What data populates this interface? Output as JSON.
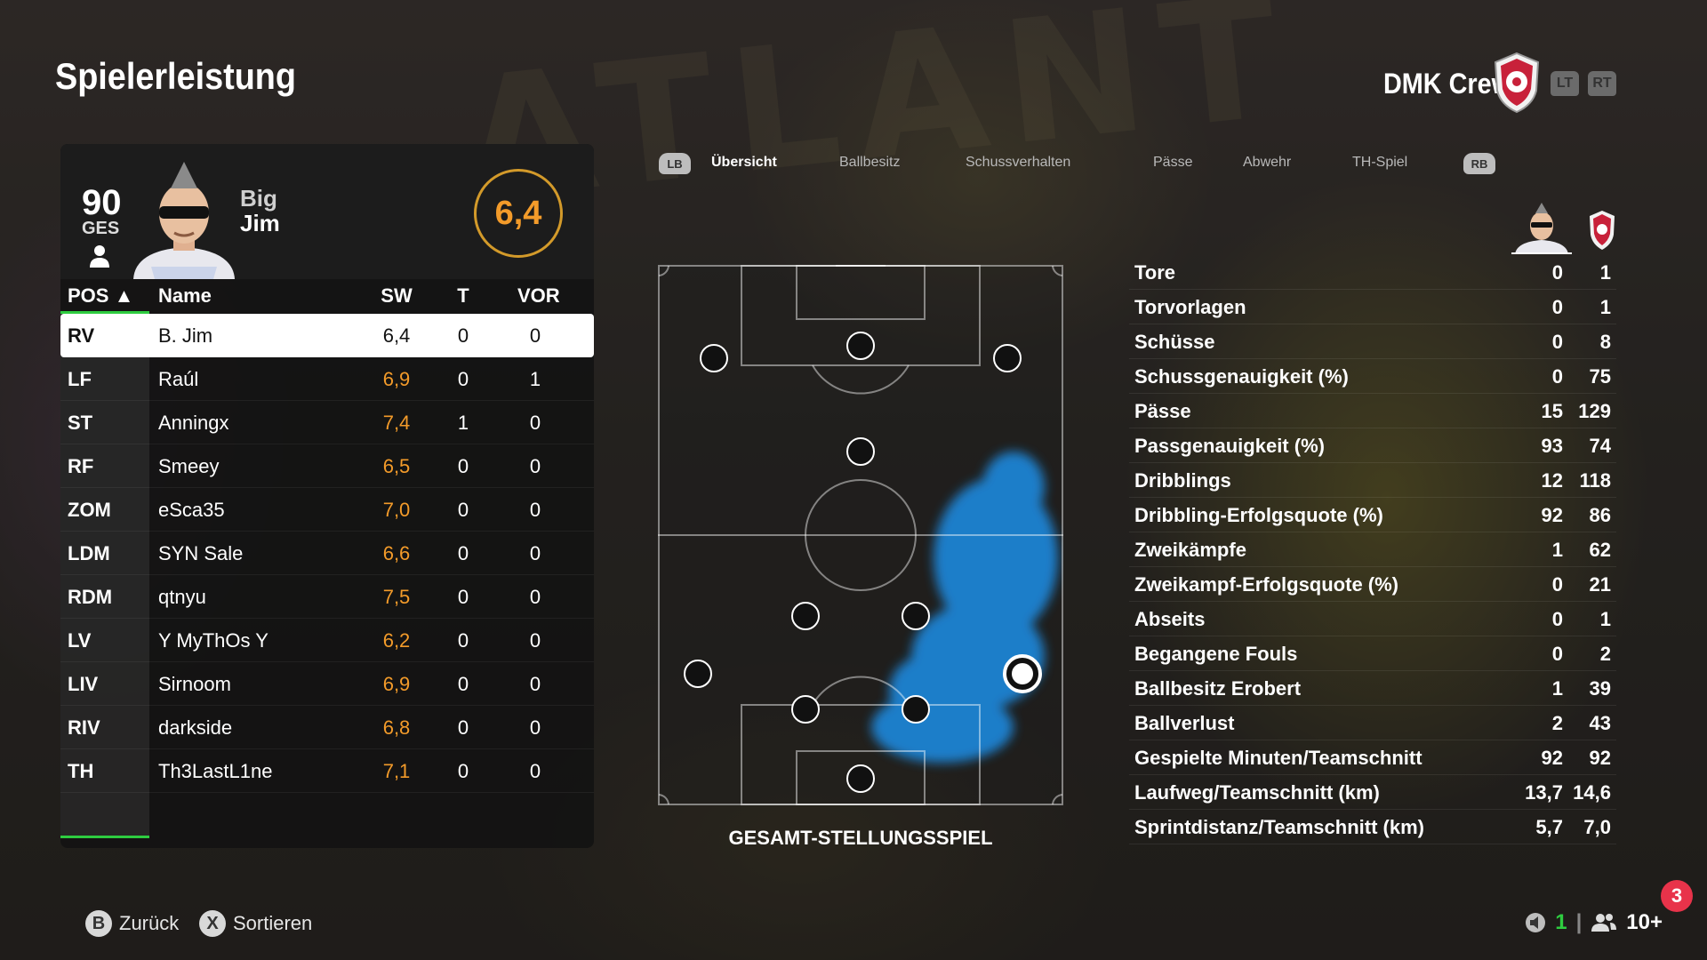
{
  "header": {
    "title": "Spielerleistung",
    "team_name": "DMK Crew",
    "lt": "LT",
    "rt": "RT"
  },
  "player_card": {
    "overall": "90",
    "overall_label": "GES",
    "first_name": "Big",
    "last_name": "Jim",
    "rating": "6,4"
  },
  "table": {
    "headers": {
      "pos": "POS ▲",
      "name": "Name",
      "sw": "SW",
      "t": "T",
      "vor": "VOR"
    },
    "rows": [
      {
        "pos": "RV",
        "name": "B. Jim",
        "sw": "6,4",
        "t": "0",
        "vor": "0"
      },
      {
        "pos": "LF",
        "name": "Raúl",
        "sw": "6,9",
        "t": "0",
        "vor": "1"
      },
      {
        "pos": "ST",
        "name": "Anningx",
        "sw": "7,4",
        "t": "1",
        "vor": "0"
      },
      {
        "pos": "RF",
        "name": "Smeey",
        "sw": "6,5",
        "t": "0",
        "vor": "0"
      },
      {
        "pos": "ZOM",
        "name": "eSca35",
        "sw": "7,0",
        "t": "0",
        "vor": "0"
      },
      {
        "pos": "LDM",
        "name": "SYN Sale",
        "sw": "6,6",
        "t": "0",
        "vor": "0"
      },
      {
        "pos": "RDM",
        "name": "qtnyu",
        "sw": "7,5",
        "t": "0",
        "vor": "0"
      },
      {
        "pos": "LV",
        "name": "Y MyThOs Y",
        "sw": "6,2",
        "t": "0",
        "vor": "0"
      },
      {
        "pos": "LIV",
        "name": "Sirnoom",
        "sw": "6,9",
        "t": "0",
        "vor": "0"
      },
      {
        "pos": "RIV",
        "name": "darkside",
        "sw": "6,8",
        "t": "0",
        "vor": "0"
      },
      {
        "pos": "TH",
        "name": "Th3LastL1ne",
        "sw": "7,1",
        "t": "0",
        "vor": "0"
      }
    ]
  },
  "tabs": {
    "lb": "LB",
    "rb": "RB",
    "items": [
      "Übersicht",
      "Ballbesitz",
      "Schussverhalten",
      "Pässe",
      "Abwehr",
      "TH-Spiel"
    ],
    "active": "Übersicht"
  },
  "pitch": {
    "label": "GESAMT-STELLUNGSSPIEL"
  },
  "stats": [
    {
      "label": "Tore",
      "player": "0",
      "team": "1"
    },
    {
      "label": "Torvorlagen",
      "player": "0",
      "team": "1"
    },
    {
      "label": "Schüsse",
      "player": "0",
      "team": "8"
    },
    {
      "label": "Schussgenauigkeit (%)",
      "player": "0",
      "team": "75"
    },
    {
      "label": "Pässe",
      "player": "15",
      "team": "129"
    },
    {
      "label": "Passgenauigkeit (%)",
      "player": "93",
      "team": "74"
    },
    {
      "label": "Dribblings",
      "player": "12",
      "team": "118"
    },
    {
      "label": "Dribbling-Erfolgsquote (%)",
      "player": "92",
      "team": "86"
    },
    {
      "label": "Zweikämpfe",
      "player": "1",
      "team": "62"
    },
    {
      "label": "Zweikampf-Erfolgsquote (%)",
      "player": "0",
      "team": "21"
    },
    {
      "label": "Abseits",
      "player": "0",
      "team": "1"
    },
    {
      "label": "Begangene Fouls",
      "player": "0",
      "team": "2"
    },
    {
      "label": "Ballbesitz Erobert",
      "player": "1",
      "team": "39"
    },
    {
      "label": "Ballverlust",
      "player": "2",
      "team": "43"
    },
    {
      "label": "Gespielte Minuten/Teamschnitt",
      "player": "92",
      "team": "92"
    },
    {
      "label": "Laufweg/Teamschnitt (km)",
      "player": "13,7",
      "team": "14,6"
    },
    {
      "label": "Sprintdistanz/Teamschnitt (km)",
      "player": "5,7",
      "team": "7,0"
    }
  ],
  "footer": {
    "back_key": "B",
    "back_label": "Zurück",
    "sort_key": "X",
    "sort_label": "Sortieren",
    "notification_count": "3",
    "voice_count": "1",
    "party_count": "10+"
  },
  "colors": {
    "accent_orange": "#f39b2a",
    "accent_green": "#2ecc40",
    "heatmap_blue": "#1a8fe8",
    "notification_red": "#e8334a"
  }
}
